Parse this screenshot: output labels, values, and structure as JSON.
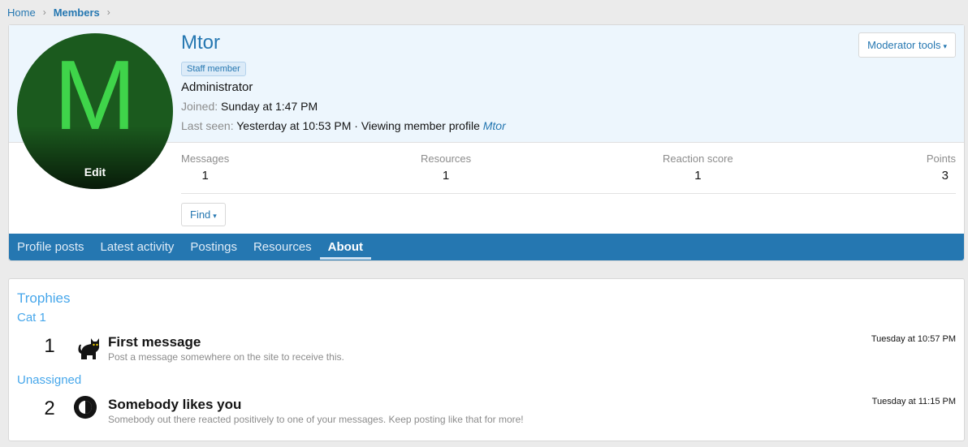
{
  "breadcrumb": {
    "home": "Home",
    "members": "Members",
    "separator": "›"
  },
  "profile": {
    "avatar_letter": "M",
    "avatar_edit": "Edit",
    "name": "Mtor",
    "badge": "Staff member",
    "title": "Administrator",
    "joined_label": "Joined:",
    "joined_value": "Sunday at 1:47 PM",
    "last_seen_label": "Last seen:",
    "last_seen_value": "Yesterday at 10:53 PM · Viewing member profile",
    "last_seen_link": "Mtor",
    "mod_tools": "Moderator tools",
    "find": "Find",
    "caret": "▾",
    "colors": {
      "accent": "#2577b1",
      "avatar_bg": "#1b5a1e",
      "avatar_letter": "#3fd44a"
    }
  },
  "stats": [
    {
      "label": "Messages",
      "value": "1"
    },
    {
      "label": "Resources",
      "value": "1"
    },
    {
      "label": "Reaction score",
      "value": "1"
    },
    {
      "label": "Points",
      "value": "3"
    }
  ],
  "tabs": [
    {
      "label": "Profile posts",
      "active": false
    },
    {
      "label": "Latest activity",
      "active": false
    },
    {
      "label": "Postings",
      "active": false
    },
    {
      "label": "Resources",
      "active": false
    },
    {
      "label": "About",
      "active": true
    }
  ],
  "trophies": {
    "heading": "Trophies",
    "groups": [
      {
        "name": "Cat 1",
        "items": [
          {
            "number": "1",
            "icon": "cat-icon",
            "title": "First message",
            "description": "Post a message somewhere on the site to receive this.",
            "date": "Tuesday at 10:57 PM"
          }
        ]
      },
      {
        "name": "Unassigned",
        "items": [
          {
            "number": "2",
            "icon": "half-circle-icon",
            "title": "Somebody likes you",
            "description": "Somebody out there reacted positively to one of your messages. Keep posting like that for more!",
            "date": "Tuesday at 11:15 PM"
          }
        ]
      }
    ]
  }
}
